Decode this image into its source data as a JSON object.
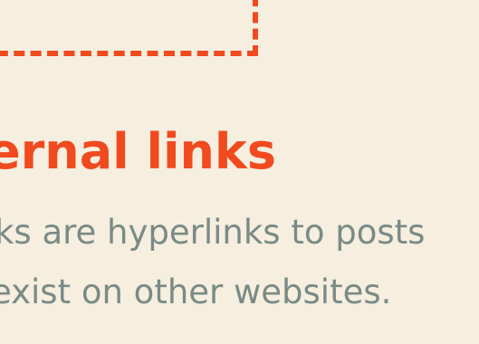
{
  "theme": {
    "background": "#F6EEDF",
    "accent": "#F04A1E",
    "body_text": "#7A8B86"
  },
  "section": {
    "heading": "ernal links",
    "body_lines": [
      "ks are hyperlinks to posts",
      "exist on other websites."
    ]
  }
}
